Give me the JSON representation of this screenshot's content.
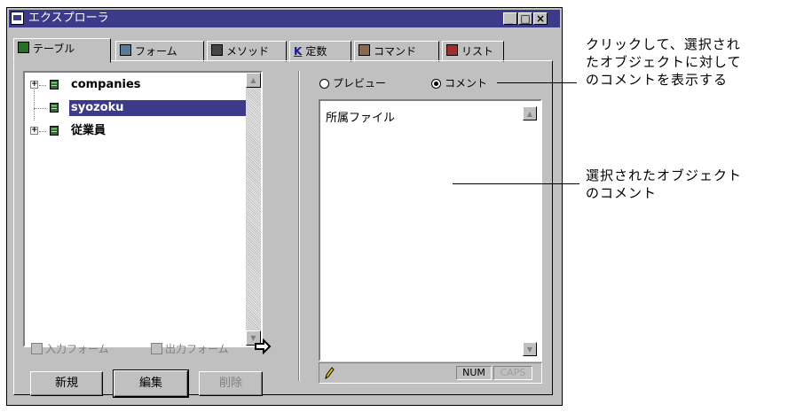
{
  "window": {
    "title": "エクスプローラ",
    "buttons": {
      "minimize": "_",
      "maximize": "□",
      "close": "×"
    }
  },
  "tabs": [
    {
      "label": "テーブル",
      "icon": "table-icon"
    },
    {
      "label": "フォーム",
      "icon": "form-icon"
    },
    {
      "label": "メソッド",
      "icon": "method-icon"
    },
    {
      "label": "定数",
      "icon": "constant-icon",
      "prefix": "K"
    },
    {
      "label": "コマンド",
      "icon": "command-icon"
    },
    {
      "label": "リスト",
      "icon": "list-icon"
    }
  ],
  "tree": {
    "items": [
      {
        "label": "companies",
        "expandable": true,
        "selected": false
      },
      {
        "label": "syozoku",
        "expandable": false,
        "selected": true
      },
      {
        "label": "従業員",
        "expandable": true,
        "selected": false
      }
    ]
  },
  "checkboxes": {
    "input_form": "入力フォーム",
    "output_form": "出力フォーム"
  },
  "buttons": {
    "new": "新規",
    "edit": "編集",
    "delete": "削除"
  },
  "view_mode": {
    "preview": "プレビュー",
    "comment": "コメント",
    "selected": "comment"
  },
  "comment_text": "所属ファイル",
  "status": {
    "num": "NUM",
    "caps": "CAPS"
  },
  "callouts": {
    "top": [
      "クリックして、選択され",
      "たオブジェクトに対して",
      "のコメントを表示する"
    ],
    "middle": [
      "選択されたオブジェクト",
      "のコメント"
    ]
  },
  "colors": {
    "titlebar": "#3b3b8a",
    "selection": "#3b3b8a",
    "face": "#c0c0c0"
  }
}
